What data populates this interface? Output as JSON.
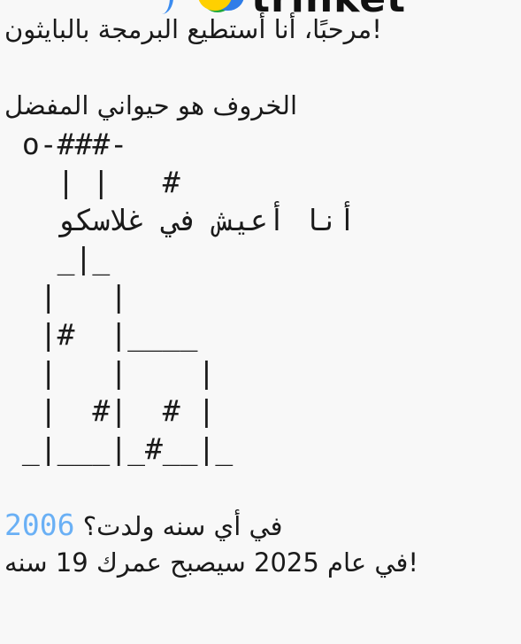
{
  "header": {
    "logo_text": "trinket"
  },
  "console": {
    "lines": [
      "مرحبًا، أنا أستطيع البرمجة بالبايثون!",
      "",
      "الخروف هو حيواني المفضل",
      " o-###-",
      "   | |   #",
      "   أنا أعيش في غلاسكو",
      "   _|_",
      "  |   |",
      "  |#  |____",
      "  |   |    |",
      "  |  #|  # |",
      " _|___|_#__|_",
      ""
    ],
    "prompt": "في أي سنه ولدت؟ ",
    "input_value": "2006",
    "result": "في عام 2025 سيصبح عمرك 19 سنه!"
  },
  "colors": {
    "input": "#6ab0f5",
    "text": "#1a1a1a",
    "background": "#f8f8f8"
  }
}
